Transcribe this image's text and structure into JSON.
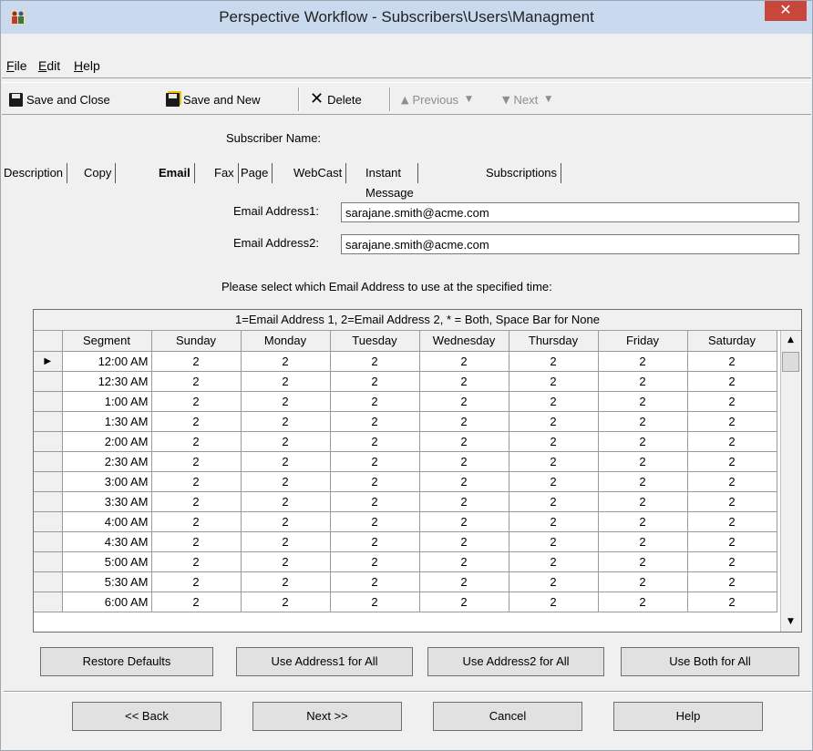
{
  "window": {
    "title": "Perspective Workflow - Subscribers\\Users\\Managment",
    "close_glyph": "✕",
    "app_icon": "people-icon"
  },
  "menu": {
    "items": [
      "File",
      "Edit",
      "Help"
    ]
  },
  "toolbar": {
    "save_close": "Save and Close",
    "save_new": "Save and New",
    "delete": "Delete",
    "previous": "Previous",
    "next": "Next"
  },
  "subscriber": {
    "label": "Subscriber Name:"
  },
  "tabs": [
    "Description",
    "Copy",
    "Email",
    "Fax",
    "Page",
    "WebCast",
    "Instant Message",
    "Subscriptions"
  ],
  "active_tab": "Email",
  "email": {
    "address1_label": "Email Address1:",
    "address1_value": "sarajane.smith@acme.com",
    "address2_label": "Email Address2:",
    "address2_value": "sarajane.smith@acme.com"
  },
  "instruction": "Please select which Email Address to use at the specified time:",
  "grid": {
    "caption": "1=Email Address 1, 2=Email Address 2, * = Both, Space Bar for None",
    "columns": [
      "Segment",
      "Sunday",
      "Monday",
      "Tuesday",
      "Wednesday",
      "Thursday",
      "Friday",
      "Saturday"
    ],
    "rows": [
      {
        "segment": "12:00 AM",
        "values": [
          "2",
          "2",
          "2",
          "2",
          "2",
          "2",
          "2"
        ]
      },
      {
        "segment": "12:30 AM",
        "values": [
          "2",
          "2",
          "2",
          "2",
          "2",
          "2",
          "2"
        ]
      },
      {
        "segment": "1:00 AM",
        "values": [
          "2",
          "2",
          "2",
          "2",
          "2",
          "2",
          "2"
        ]
      },
      {
        "segment": "1:30 AM",
        "values": [
          "2",
          "2",
          "2",
          "2",
          "2",
          "2",
          "2"
        ]
      },
      {
        "segment": "2:00 AM",
        "values": [
          "2",
          "2",
          "2",
          "2",
          "2",
          "2",
          "2"
        ]
      },
      {
        "segment": "2:30 AM",
        "values": [
          "2",
          "2",
          "2",
          "2",
          "2",
          "2",
          "2"
        ]
      },
      {
        "segment": "3:00 AM",
        "values": [
          "2",
          "2",
          "2",
          "2",
          "2",
          "2",
          "2"
        ]
      },
      {
        "segment": "3:30 AM",
        "values": [
          "2",
          "2",
          "2",
          "2",
          "2",
          "2",
          "2"
        ]
      },
      {
        "segment": "4:00 AM",
        "values": [
          "2",
          "2",
          "2",
          "2",
          "2",
          "2",
          "2"
        ]
      },
      {
        "segment": "4:30 AM",
        "values": [
          "2",
          "2",
          "2",
          "2",
          "2",
          "2",
          "2"
        ]
      },
      {
        "segment": "5:00 AM",
        "values": [
          "2",
          "2",
          "2",
          "2",
          "2",
          "2",
          "2"
        ]
      },
      {
        "segment": "5:30 AM",
        "values": [
          "2",
          "2",
          "2",
          "2",
          "2",
          "2",
          "2"
        ]
      },
      {
        "segment": "6:00 AM",
        "values": [
          "2",
          "2",
          "2",
          "2",
          "2",
          "2",
          "2"
        ]
      }
    ]
  },
  "grid_buttons": [
    "Restore Defaults",
    "Use Address1 for All",
    "Use Address2 for All",
    "Use Both for All"
  ],
  "nav_buttons": {
    "back": "<< Back",
    "next": "Next >>",
    "cancel": "Cancel",
    "help": "Help"
  }
}
